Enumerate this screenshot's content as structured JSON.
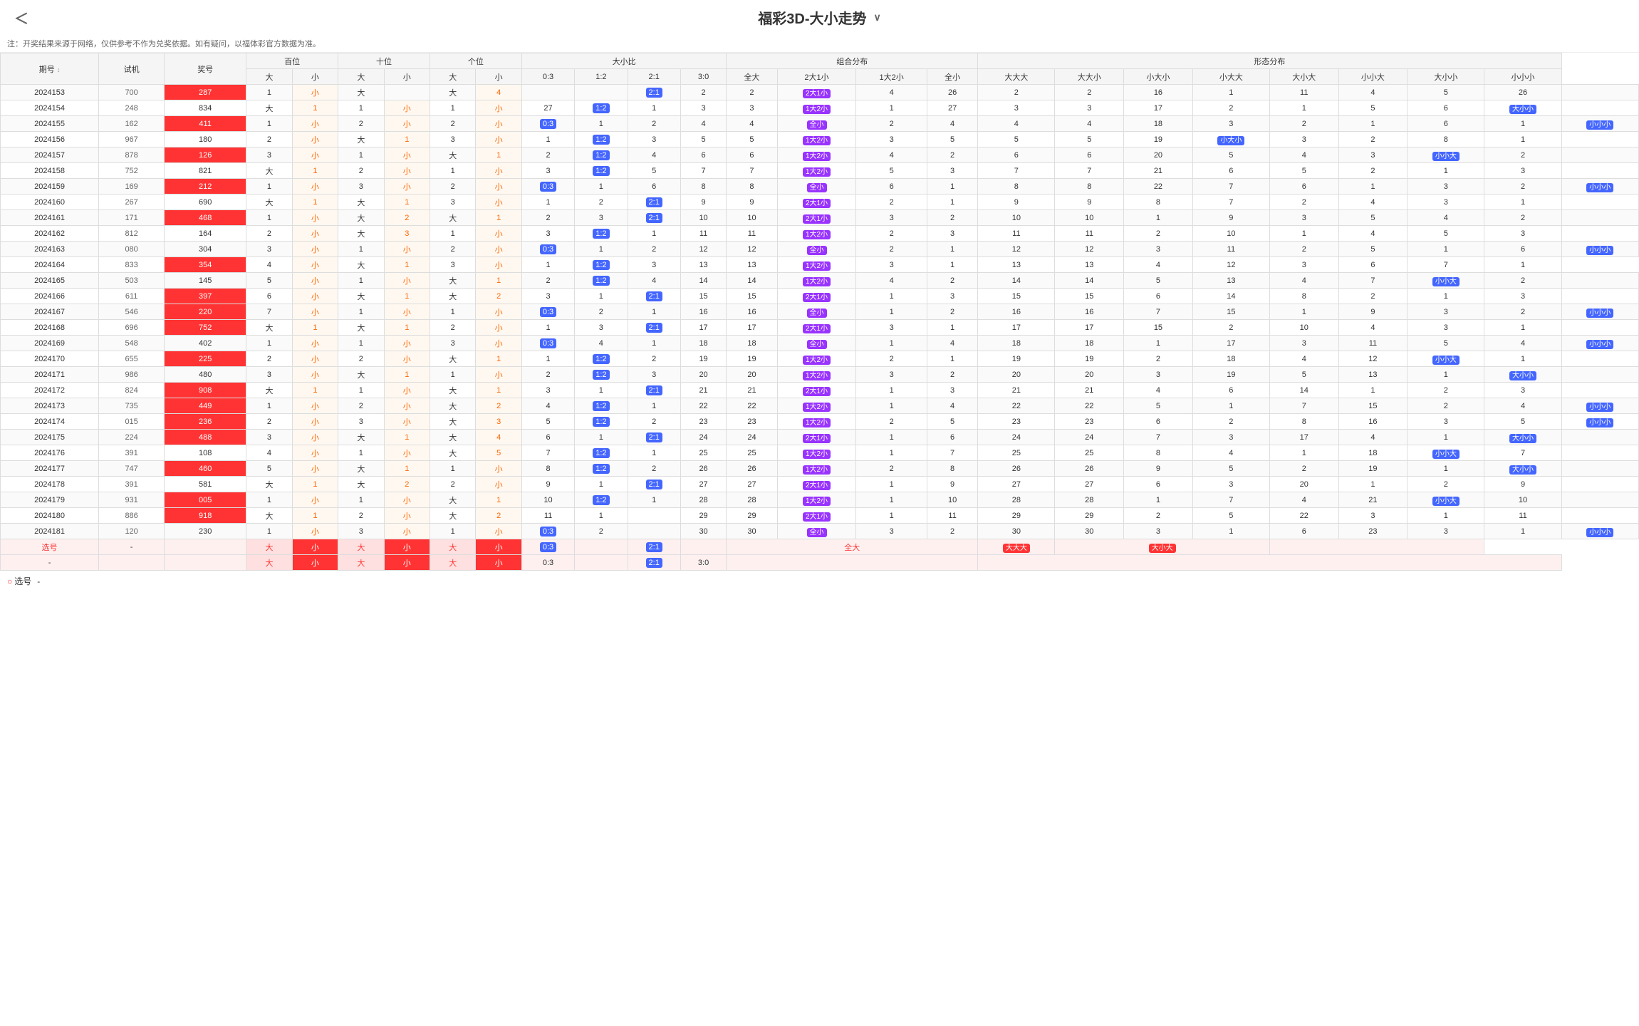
{
  "page": {
    "title": "福彩3D-大小走势",
    "back_label": "‹",
    "dropdown_icon": "∨",
    "notice": "注：开奖结果来源于网络，仅供参考不作为兑奖依据。如有疑问，以福体彩官方数据为准。"
  },
  "table": {
    "headers": {
      "qihao": "期号",
      "shiji": "试机",
      "jianghao": "奖号",
      "baiwei": "百位",
      "shiwei": "十位",
      "gewei": "个位",
      "daxiaobi": "大小比",
      "zuhe": "组合分布",
      "xingzhuang": "形态分布"
    },
    "sub_headers": {
      "da": "大",
      "xiao": "小",
      "ratio_03": "0:3",
      "ratio_12": "1:2",
      "ratio_21": "2:1",
      "ratio_30": "3:0",
      "quanda": "全大",
      "two_da_one_xiao": "2大1小",
      "one_da_two_xiao": "1大2小",
      "quanxiao": "全小",
      "da_da_da": "大大大",
      "da_da_xiao": "大大小",
      "xiao_da_xiao": "小大小",
      "xiao_da_da": "小大大",
      "da_xiao_da": "大小大",
      "xiao_xiao_da": "小小大",
      "da_xiao_xiao": "大小小",
      "xiao_xiao_xiao": "小小小"
    }
  }
}
